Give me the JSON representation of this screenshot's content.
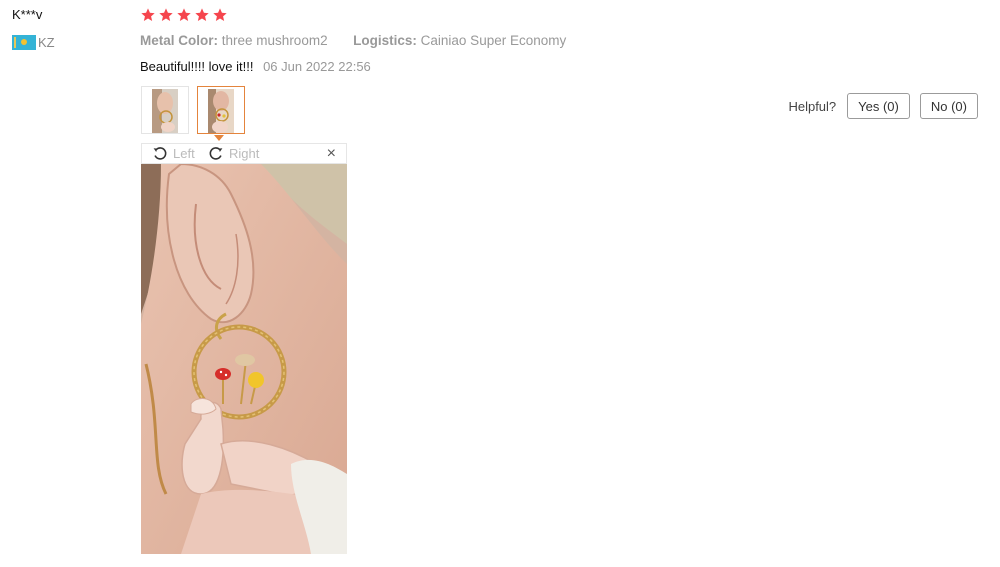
{
  "reviewer": {
    "name": "K***v",
    "country_code": "KZ",
    "flag_icon": "kazakhstan-flag-icon"
  },
  "rating": {
    "stars": 5,
    "max": 5,
    "color": "#f5454d"
  },
  "attributes": [
    {
      "label": "Metal Color:",
      "value": "three mushroom2"
    },
    {
      "label": "Logistics:",
      "value": "Cainiao Super Economy"
    }
  ],
  "review": {
    "text": "Beautiful!!!! love it!!!",
    "date": "06 Jun 2022 22:56"
  },
  "photos": {
    "count": 2,
    "selected_index": 1,
    "accent": "#e4843c"
  },
  "viewer": {
    "rotate_left_label": "Left",
    "rotate_right_label": "Right",
    "close_glyph": "×",
    "icons": [
      "rotate-left-icon",
      "rotate-right-icon",
      "close-icon"
    ]
  },
  "helpful": {
    "label": "Helpful?",
    "yes_label": "Yes (0)",
    "no_label": "No (0)"
  }
}
